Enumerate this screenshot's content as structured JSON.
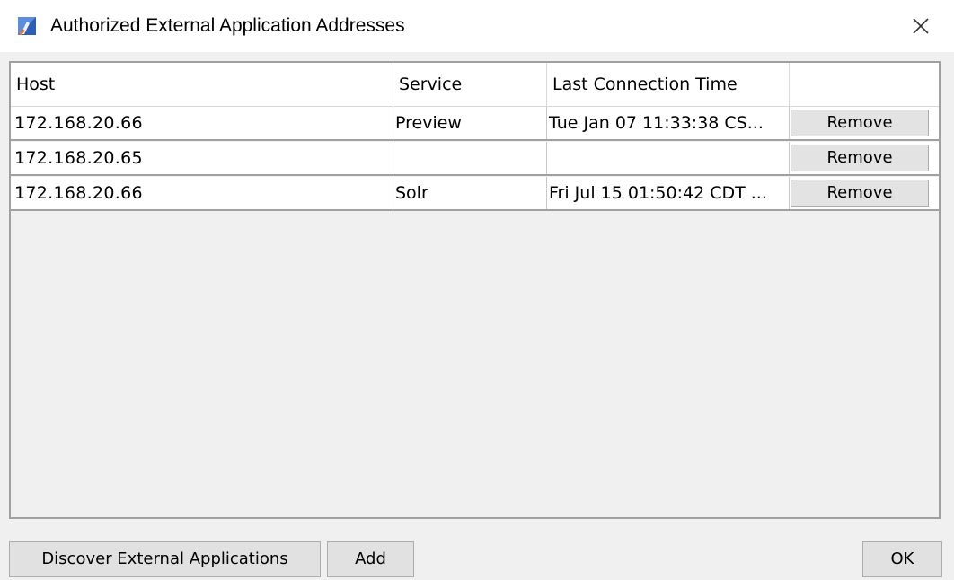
{
  "window": {
    "title": "Authorized External Application Addresses",
    "app_icon": "app-logo-icon",
    "close_icon": "close-icon"
  },
  "table": {
    "columns": [
      "Host",
      "Service",
      "Last Connection Time",
      ""
    ],
    "rows": [
      {
        "host": "172.168.20.66",
        "service": "Preview",
        "last_connection": "Tue Jan 07 11:33:38 CS...",
        "action": "Remove"
      },
      {
        "host": "172.168.20.65",
        "service": "",
        "last_connection": "",
        "action": "Remove"
      },
      {
        "host": "172.168.20.66",
        "service": "Solr",
        "last_connection": "Fri Jul 15 01:50:42 CDT ...",
        "action": "Remove"
      }
    ]
  },
  "buttons": {
    "discover": "Discover External Applications",
    "add": "Add",
    "ok": "OK"
  },
  "colors": {
    "background": "#f0f0f0",
    "titlebar": "#ffffff",
    "button_face": "#e1e1e1",
    "border": "#a0a0a0"
  }
}
